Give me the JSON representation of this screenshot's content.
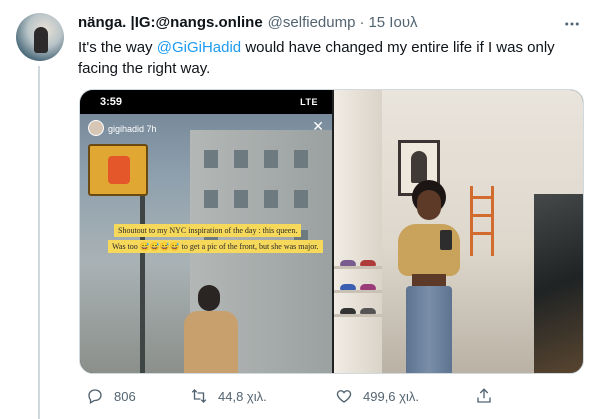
{
  "tweet": {
    "display_name": "nänga. |IG:@nangs.online",
    "handle": "@selfiedump",
    "separator": "·",
    "date": "15 Ιουλ",
    "text_before": "It's the way ",
    "mention": "@GiGiHadid",
    "text_after": " would have changed my entire life if I was only facing the right way."
  },
  "media": {
    "story_clock": "3:59",
    "story_status": "LTE",
    "story_user": "gigihadid",
    "story_age": "7h",
    "caption_line1": "Shoutout to my NYC inspiration of the day : this queen.",
    "caption_line2": "Was too 😅😅😅😅 to get a pic of the front, but she was major."
  },
  "actions": {
    "reply_count": "806",
    "retweet_count": "44,8 χιλ.",
    "like_count": "499,6 χιλ."
  },
  "colors": {
    "link": "#1d9bf0",
    "secondary_text": "#536471",
    "primary_text": "#0f1419",
    "border": "#cfd9de"
  },
  "icons": [
    "more-icon",
    "reply-icon",
    "retweet-icon",
    "like-icon",
    "share-icon",
    "close-icon"
  ]
}
